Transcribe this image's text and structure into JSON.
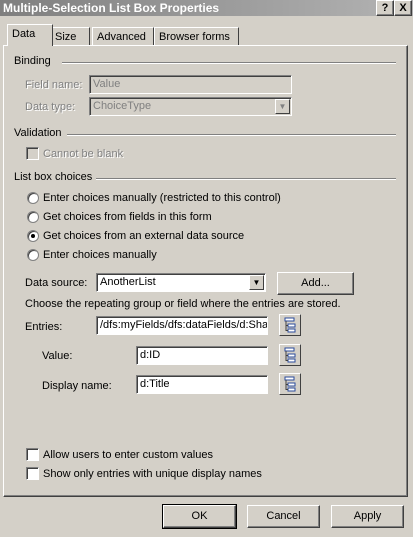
{
  "window": {
    "title": "Multiple-Selection List Box Properties",
    "help_glyph": "?",
    "close_glyph": "X"
  },
  "tabs": [
    {
      "label": "Data"
    },
    {
      "label": "Size"
    },
    {
      "label": "Advanced"
    },
    {
      "label": "Browser forms"
    }
  ],
  "binding": {
    "heading": "Binding",
    "field_name_label": "Field name:",
    "field_name_value": "Value",
    "data_type_label": "Data type:",
    "data_type_value": "ChoiceType"
  },
  "validation": {
    "heading": "Validation",
    "cannot_be_blank": "Cannot be blank"
  },
  "list_box": {
    "heading": "List box choices",
    "options": [
      {
        "label": "Enter choices manually (restricted to this control)",
        "selected": false
      },
      {
        "label": "Get choices from fields in this form",
        "selected": false
      },
      {
        "label": "Get choices from an external data source",
        "selected": true
      },
      {
        "label": "Enter choices manually",
        "selected": false
      }
    ],
    "data_source_label": "Data source:",
    "data_source_value": "AnotherList",
    "add_button": "Add...",
    "repeat_note": "Choose the repeating group or field where the entries are stored.",
    "entries_label": "Entries:",
    "entries_value": "/dfs:myFields/dfs:dataFields/d:SharedListItem",
    "value_label": "Value:",
    "value_value": "d:ID",
    "display_label": "Display name:",
    "display_value": "d:Title"
  },
  "options": {
    "custom_values": "Allow users to enter custom values",
    "unique_names": "Show only entries with unique display names"
  },
  "footer": {
    "ok": "OK",
    "cancel": "Cancel",
    "apply": "Apply"
  }
}
